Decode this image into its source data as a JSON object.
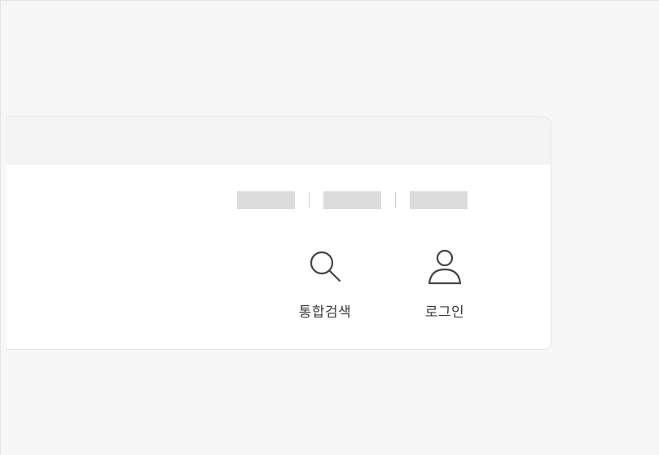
{
  "header": {
    "utility_links": [
      {
        "label": ""
      },
      {
        "label": ""
      },
      {
        "label": ""
      }
    ],
    "actions": {
      "search": {
        "label": "통합검색",
        "icon": "search-icon"
      },
      "login": {
        "label": "로그인",
        "icon": "user-icon"
      }
    }
  },
  "colors": {
    "page_background": "#f7f7f7",
    "card_background": "#ffffff",
    "topbar_background": "#f3f3f3",
    "placeholder": "#dcdcdc",
    "icon_stroke": "#444444",
    "label_text": "#3a3a3a"
  }
}
